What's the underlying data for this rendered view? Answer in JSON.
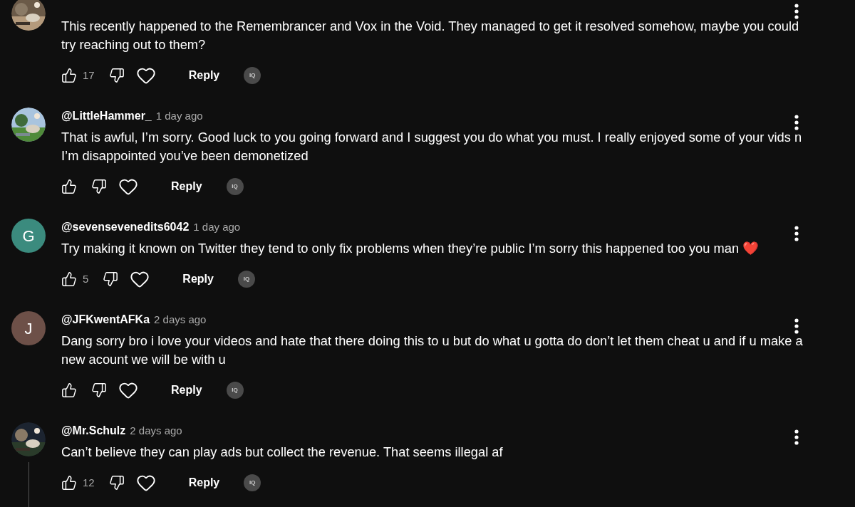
{
  "comments": [
    {
      "text": "This recently happened to the Remembrancer and Vox in the Void. They managed to get it resolved somehow, maybe you could try reaching out to them?",
      "likes": "17",
      "reply": "Reply",
      "badge": "IQ",
      "thread": false
    },
    {
      "author": "@LittleHammer_",
      "time": "1 day ago",
      "text": "That is awful, I’m sorry. Good luck to you going forward and I suggest you do what you must. I really enjoyed some of your vids n I’m disappointed you’ve been demonetized",
      "reply": "Reply",
      "badge": "IQ",
      "thread": false
    },
    {
      "author": "@sevensevenedits6042",
      "time": "1 day ago",
      "avatar": {
        "kind": "letter",
        "letter": "G",
        "color": "#3b8b7e"
      },
      "text": "Try making it known on Twitter they tend to only fix problems when they’re public I’m sorry this happened too you man ❤️",
      "likes": "5",
      "reply": "Reply",
      "badge": "IQ",
      "thread": false
    },
    {
      "author": "@JFKwentAFKa",
      "time": "2 days ago",
      "avatar": {
        "kind": "letter",
        "letter": "J",
        "color": "#6d5048"
      },
      "text": "Dang sorry bro i love your videos and hate that there doing this to u but do what u gotta do don’t let them cheat u and if u make a new acount we will be with u",
      "reply": "Reply",
      "badge": "IQ",
      "thread": false
    },
    {
      "author": "@Mr.Schulz",
      "time": "2 days ago",
      "text": "Can’t believe they can play ads but collect the revenue. That seems illegal af",
      "likes": "12",
      "reply": "Reply",
      "badge": "IQ",
      "thread": true
    }
  ]
}
